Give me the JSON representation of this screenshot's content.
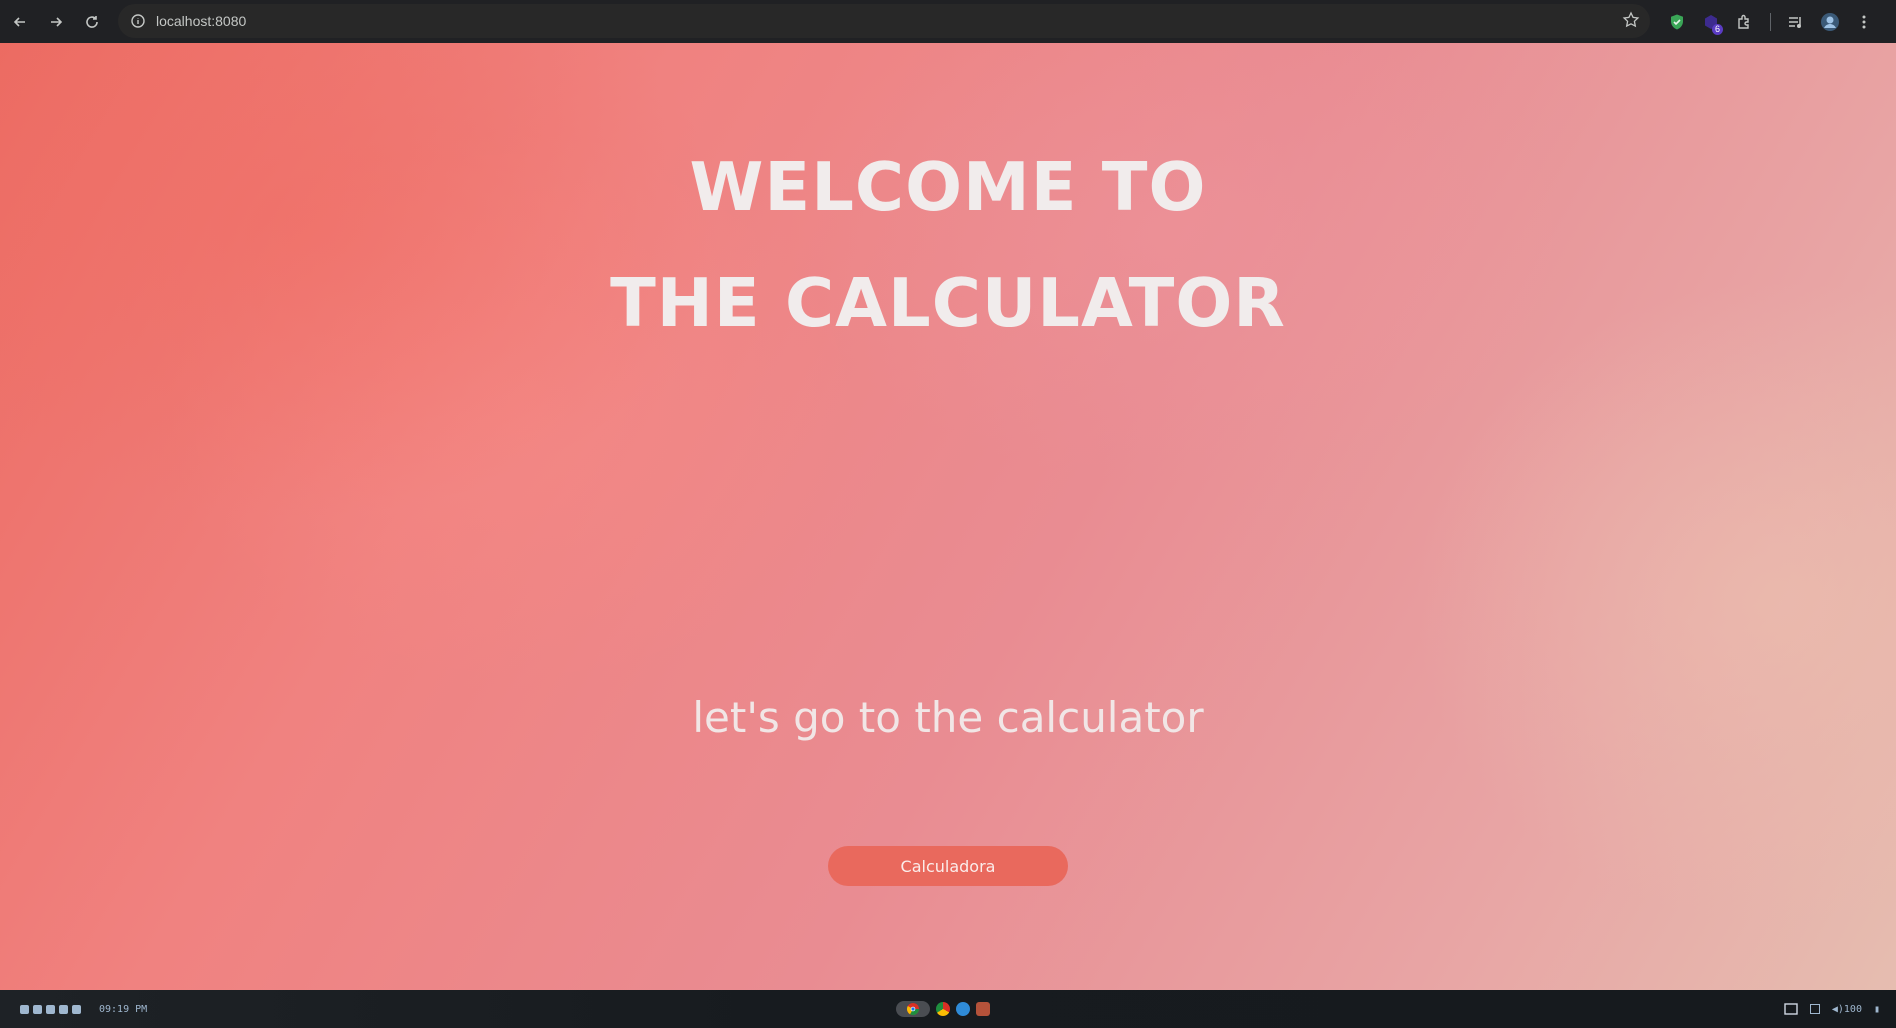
{
  "browser": {
    "url": "localhost:8080",
    "extension_badge_count": "6"
  },
  "page": {
    "title_line1": "WELCOME TO",
    "title_line2": "THE CALCULATOR",
    "subtitle": "let's go to the calculator",
    "button_label": "Calculadora",
    "button_color": "#e9695d",
    "background_colors": [
      "#ec6b62",
      "#f08280",
      "#e98c92",
      "#e8a4a4",
      "#e6bdb0"
    ]
  },
  "taskbar": {
    "clock": "09:19 PM",
    "volume": "100"
  }
}
